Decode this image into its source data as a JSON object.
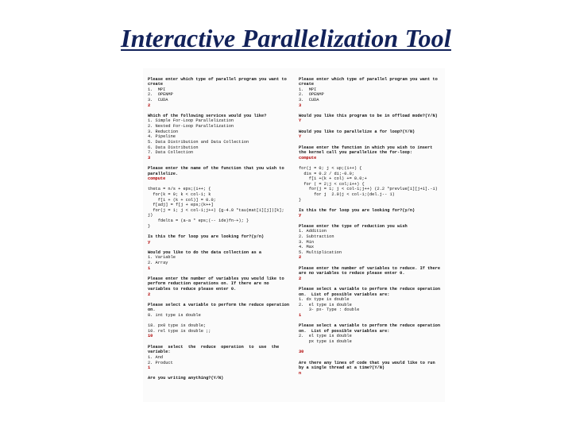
{
  "title": "Interactive Parallelization Tool",
  "left": {
    "p1_header": "Please enter which type of parallel program you want to create",
    "p1_opts": "1.  MPI\n2.  OPENMP\n3.  CUDA",
    "p1_ans": "2",
    "p2_header": "Which of the following services would you like?",
    "p2_opts": "1. Simple For-Loop Parallelization\n2. Nested For-Loop Parallelization\n3. Reduction\n4. Pipeline\n5. Data Distribution and Data Collection\n6. Data Distribution\n7. Data Collection",
    "p2_ans": "3",
    "p3_header": "Please enter the name of the function that you wish to parallelize.",
    "p3_ans": "compute",
    "code": "theta = n/s + eps;(i++; {\n  for(k = 0; k < col-1; k\n    f[i + (k + col)] = 0.0;\n  f[adj] = f[j + eps;(k++]\n  for(j = 1; j < col-1;j++) {g-4.0 *tau(mat[i][j])[k]; j)\n    fdelta = (a-a * eps;(-- ide)fn-+); }\n}",
    "p4_q": "Is this the for loop you are looking for?(y/n)",
    "p4_ans": "y",
    "p5_header": "Would you like to do the data collection as a",
    "p5_opts": "1. Variable\n2. Array",
    "p5_ans": "1",
    "p6_header": "Please enter the number of variables you would like to perform reduction operations on. If there are no variables to reduce please enter 0.",
    "p6_ans": "2",
    "p7_header": "Please select a variable to perform the reduce operation on.",
    "p7_opts": "8. int type is double\n\n18. px0 type is double;\n10. rel type is double ;;",
    "p7_ans": "10",
    "p8_header": "Please  select  the  reduce  operation  to  use  the variable:",
    "p8_opts": "1. And\n2. Product",
    "p8_ans": "1",
    "p9_q": "Are you writing anything?(Y/N)"
  },
  "right": {
    "p1_header": "Please enter which type of parallel program you want to create",
    "p1_opts": "1.  MPI\n2.  OPENMP\n3.  CUDA",
    "p1_ans": "3",
    "p2_q": "Would you like this program to be in offload mode?(Y/N)",
    "p2_ans": "Y",
    "p3_q": "Would you like to parallelize a for loop?(Y/N)",
    "p3_ans": "Y",
    "p4_header": "Please enter the function in which you wish to insert the kernel call you parallelize the for-loop:",
    "p4_ans": "compute",
    "code": "for(j = 0; j < up;(i++) {\n  dis = 0.2 / di;-0.0;\n    f[i +(k + col) += 0.0;+\n  for ( = 2;j < col;i++) {\n    for(j = 1; j < col-1;j++) (2.2 *prevlue[i][j+1].-i)\n      for j  2.0)j < col-1;(del.j-- 1)\n}",
    "p5_q": "Is this the for loop you are looking for?(y/n)",
    "p5_ans": "y",
    "p6_header": "Please enter the type of reduction you wish",
    "p6_opts": "1. Addition\n2. Subtraction\n3. Min\n4. Max\n5. Multiplication",
    "p6_ans": "2",
    "p7_header": "Please enter the number of variables to reduce. If there are no variables to reduce please enter 0.",
    "p7_ans": "2",
    "p8_header": "Please select a variable to perform the reduce operation on.  List of possible variables are:",
    "p8_opts": "1. dx type is double\n2.  el type is double\n    3- px- Type : double",
    "p8_ans": "1",
    "p9_header": "Please select a variable to perform the reduce operation on.  List of possible variables are:",
    "p9_opts": "2.  el type is double\n    px type is double\n",
    "p9_ans": "30",
    "p10_q": "Are there any lines of code that you would like to run by a single thread at a time?(Y/N)",
    "p10_ans": "n"
  }
}
